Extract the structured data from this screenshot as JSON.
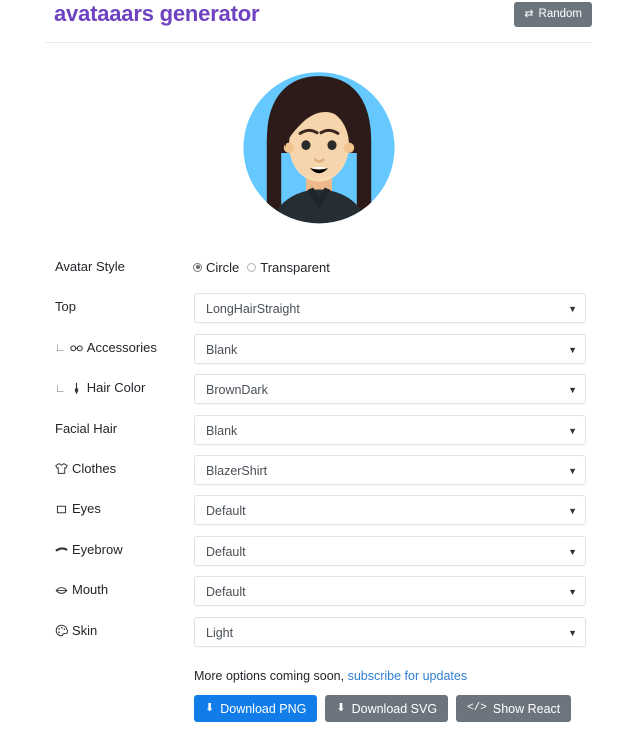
{
  "header": {
    "title": "avataaars generator",
    "random_button": {
      "label": "Random",
      "icon": "shuffle-icon"
    },
    "title_color": "#6f42c1",
    "random_button_color": "#6c757d"
  },
  "avatar": {
    "style": "Circle",
    "background_color": "#65C9FF",
    "skin_color": "#F8D9B0",
    "hair_color": "#2C1B18",
    "clothes_color": "#262E33",
    "top": "LongHairStraight",
    "eyes": "Default",
    "eyebrow": "Default",
    "mouth": "Default",
    "facial_hair": "Blank",
    "accessories": "Blank"
  },
  "form": {
    "avatar_style": {
      "label": "Avatar Style",
      "options": [
        {
          "label": "Circle",
          "selected": true
        },
        {
          "label": "Transparent",
          "selected": false
        }
      ]
    },
    "rows": [
      {
        "label": "Top",
        "icon": null,
        "indented": false,
        "value": "LongHairStraight"
      },
      {
        "label": "Accessories",
        "icon": "glasses-icon",
        "indented": true,
        "value": "Blank"
      },
      {
        "label": "Hair Color",
        "icon": "paintbrush-icon",
        "indented": true,
        "value": "BrownDark"
      },
      {
        "label": "Facial Hair",
        "icon": null,
        "indented": false,
        "value": "Blank"
      },
      {
        "label": "Clothes",
        "icon": "tshirt-icon",
        "indented": false,
        "value": "BlazerShirt"
      },
      {
        "label": "Eyes",
        "icon": "eye-icon",
        "indented": false,
        "value": "Default"
      },
      {
        "label": "Eyebrow",
        "icon": "eyebrow-icon",
        "indented": false,
        "value": "Default"
      },
      {
        "label": "Mouth",
        "icon": "lips-icon",
        "indented": false,
        "value": "Default"
      },
      {
        "label": "Skin",
        "icon": "palette-icon",
        "indented": false,
        "value": "Light"
      }
    ]
  },
  "footer": {
    "note_text": "More options coming soon,",
    "note_link": "subscribe for updates",
    "buttons": [
      {
        "label": "Download PNG",
        "icon": "download-icon",
        "style": "primary",
        "color": "#127de8"
      },
      {
        "label": "Download SVG",
        "icon": "download-icon",
        "style": "secondary",
        "color": "#6c757d"
      },
      {
        "label": "Show React",
        "icon": "code-icon",
        "style": "secondary",
        "color": "#6c757d"
      }
    ]
  }
}
